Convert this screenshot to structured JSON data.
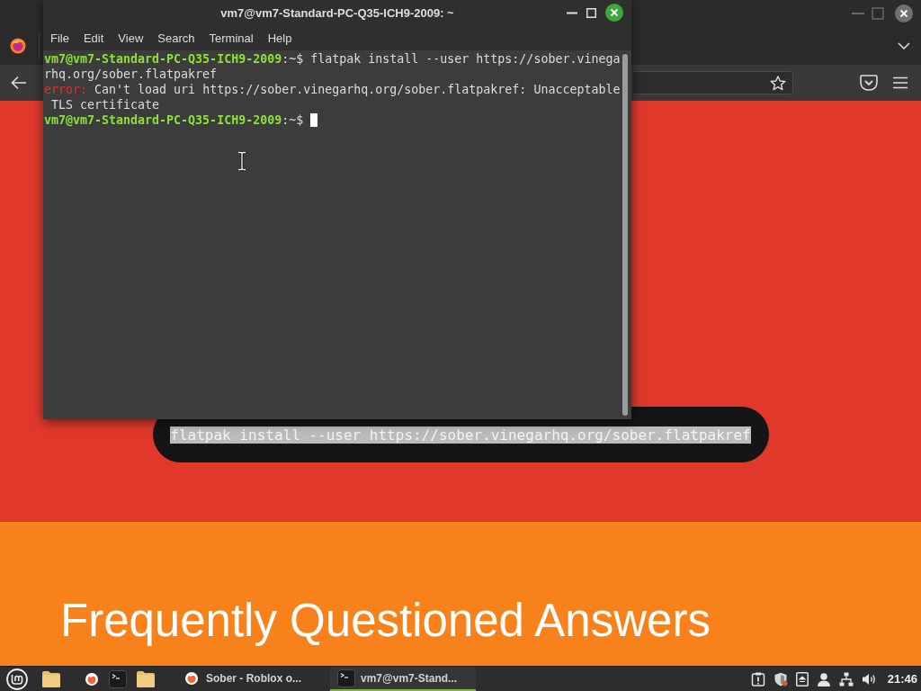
{
  "browser": {
    "page": {
      "code_block": {
        "text": "flatpak install --user https://sober.vinegarhq.org/sober.flatpakref",
        "selected": true
      },
      "heading": "Frequently Questioned Answers"
    }
  },
  "terminal": {
    "title": "vm7@vm7-Standard-PC-Q35-ICH9-2009: ~",
    "menu": [
      "File",
      "Edit",
      "View",
      "Search",
      "Terminal",
      "Help"
    ],
    "lines": [
      {
        "segments": [
          {
            "kind": "prompt",
            "text": "vm7@vm7-Standard-PC-Q35-ICH9-2009"
          },
          {
            "kind": "plain",
            "text": ":~$ flatpak install --user https://sober.vinega"
          }
        ],
        "cursor": false
      },
      {
        "segments": [
          {
            "kind": "plain",
            "text": "rhq.org/sober.flatpakref"
          }
        ],
        "cursor": false
      },
      {
        "segments": [
          {
            "kind": "error",
            "text": "error:"
          },
          {
            "kind": "plain",
            "text": " Can't load uri https://sober.vinegarhq.org/sober.flatpakref: Unacceptable"
          }
        ],
        "cursor": false
      },
      {
        "segments": [
          {
            "kind": "plain",
            "text": " TLS certificate"
          }
        ],
        "cursor": false
      },
      {
        "segments": [
          {
            "kind": "prompt",
            "text": "vm7@vm7-Standard-PC-Q35-ICH9-2009"
          },
          {
            "kind": "plain",
            "text": ":~$"
          }
        ],
        "cursor": true
      }
    ]
  },
  "taskbar": {
    "windows": [
      {
        "kind": "browser",
        "label": "Sober - Roblox o...",
        "selected": false
      },
      {
        "kind": "terminal",
        "label": "vm7@vm7-Stand...",
        "selected": true
      }
    ],
    "clock": "21:46"
  }
}
